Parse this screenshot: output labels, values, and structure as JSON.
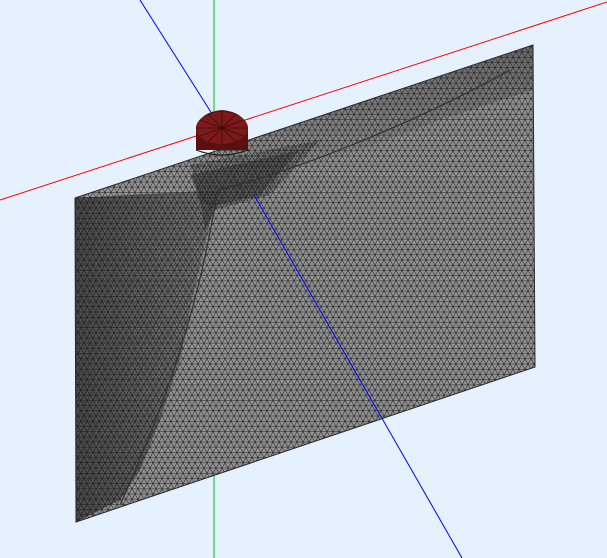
{
  "viewport": {
    "background": "#e6f1ff",
    "description_free": true
  },
  "axes": {
    "x_axis_color": "#ff0000",
    "y_axis_color": "#00c800",
    "z_axis_color": "#0000ff"
  },
  "mesh": {
    "surface_color": "#8c8c8c",
    "shadow_color": "#5e5e5e",
    "edge_color": "#1a1a1a",
    "element_type": "triangle"
  },
  "feed": {
    "cap_color": "#7a1a1a",
    "wire_color": "#2a0000"
  }
}
